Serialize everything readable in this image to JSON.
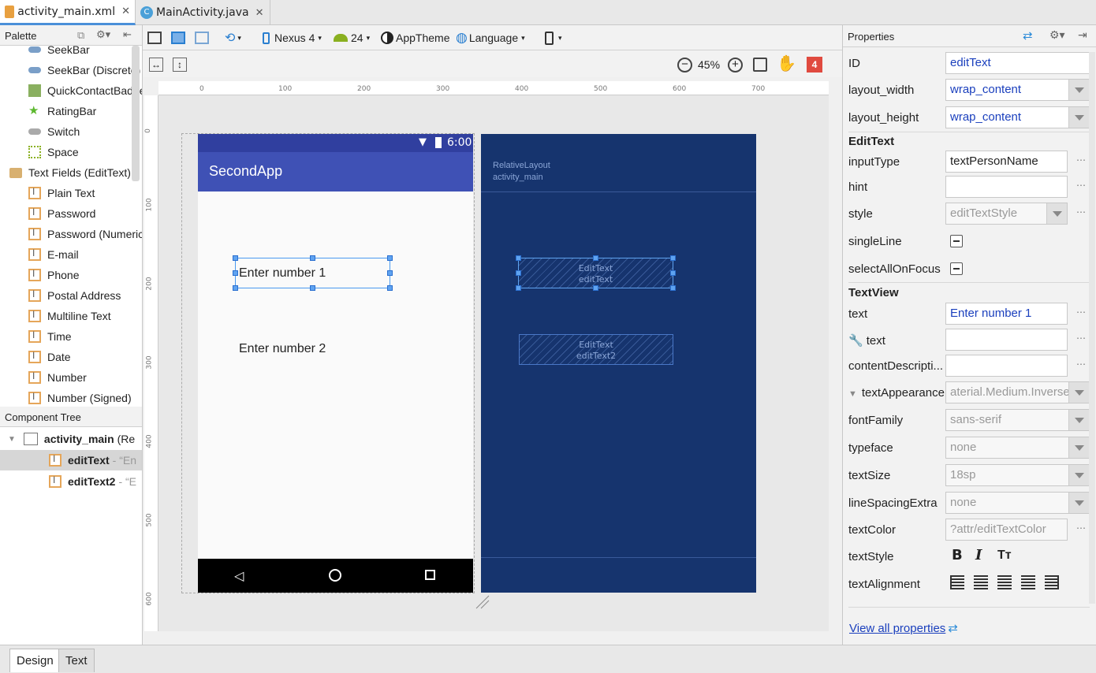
{
  "tabs": [
    {
      "label": "activity_main.xml",
      "active": true
    },
    {
      "label": "MainActivity.java",
      "active": false
    }
  ],
  "palette": {
    "title": "Palette",
    "items": [
      {
        "label": "SeekBar",
        "icon": "seekbar-icon"
      },
      {
        "label": "SeekBar (Discrete)",
        "icon": "seekbar-icon"
      },
      {
        "label": "QuickContactBadge",
        "icon": "contact-badge-icon"
      },
      {
        "label": "RatingBar",
        "icon": "star-icon"
      },
      {
        "label": "Switch",
        "icon": "switch-icon"
      },
      {
        "label": "Space",
        "icon": "space-icon"
      },
      {
        "label": "Text Fields (EditText)",
        "icon": "folder-icon",
        "category": true
      },
      {
        "label": "Plain Text",
        "icon": "edittext-icon"
      },
      {
        "label": "Password",
        "icon": "edittext-icon"
      },
      {
        "label": "Password (Numeric)",
        "icon": "edittext-icon"
      },
      {
        "label": "E-mail",
        "icon": "edittext-icon"
      },
      {
        "label": "Phone",
        "icon": "edittext-icon"
      },
      {
        "label": "Postal Address",
        "icon": "edittext-icon"
      },
      {
        "label": "Multiline Text",
        "icon": "edittext-icon"
      },
      {
        "label": "Time",
        "icon": "edittext-icon"
      },
      {
        "label": "Date",
        "icon": "edittext-icon"
      },
      {
        "label": "Number",
        "icon": "edittext-icon"
      },
      {
        "label": "Number (Signed)",
        "icon": "edittext-icon"
      }
    ]
  },
  "component_tree": {
    "title": "Component Tree",
    "root": {
      "name": "activity_main",
      "suffix": "(Re"
    },
    "children": [
      {
        "name": "editText",
        "hint": "- “En",
        "selected": true
      },
      {
        "name": "editText2",
        "hint": "- “E",
        "selected": false
      }
    ]
  },
  "toolbar": {
    "device": "Nexus 4",
    "api": "24",
    "theme": "AppTheme",
    "language": "Language",
    "zoom": "45%",
    "warnings": "4"
  },
  "ruler": {
    "top": [
      "0",
      "100",
      "200",
      "300",
      "400",
      "500",
      "600",
      "700"
    ],
    "left": [
      "0",
      "100",
      "200",
      "300",
      "400",
      "500",
      "600"
    ]
  },
  "device": {
    "time": "6:00",
    "app_title": "SecondApp",
    "edit1": "Enter number 1",
    "edit2": "Enter number 2"
  },
  "blueprint": {
    "layout_type": "RelativeLayout",
    "layout_id": "activity_main",
    "w1_type": "EditText",
    "w1_id": "editText",
    "w2_type": "EditText",
    "w2_id": "editText2"
  },
  "properties": {
    "title": "Properties",
    "id_label": "ID",
    "id_value": "editText",
    "lw_label": "layout_width",
    "lw_value": "wrap_content",
    "lh_label": "layout_height",
    "lh_value": "wrap_content",
    "sect_edittext": "EditText",
    "inputType_label": "inputType",
    "inputType_value": "textPersonName",
    "hint_label": "hint",
    "hint_value": "",
    "style_label": "style",
    "style_value": "editTextStyle",
    "singleLine_label": "singleLine",
    "selectAll_label": "selectAllOnFocus",
    "sect_textview": "TextView",
    "text_label": "text",
    "text_value": "Enter number 1",
    "tooltext_label": "text",
    "tooltext_value": "",
    "cdesc_label": "contentDescripti...",
    "cdesc_value": "",
    "tapp_label": "textAppearance",
    "tapp_value": "aterial.Medium.Inverse",
    "ff_label": "fontFamily",
    "ff_value": "sans-serif",
    "tf_label": "typeface",
    "tf_value": "none",
    "ts_label": "textSize",
    "ts_value": "18sp",
    "lse_label": "lineSpacingExtra",
    "lse_value": "none",
    "tc_label": "textColor",
    "tc_value": "?attr/editTextColor",
    "tstyle_label": "textStyle",
    "talign_label": "textAlignment",
    "view_all": "View all properties"
  },
  "bottom_tabs": [
    "Design",
    "Text"
  ],
  "colors": {
    "appbar": "#3f51b5",
    "statusbar": "#303f9f",
    "blueprint": "#16346e",
    "selection": "#5fa3f0",
    "warning": "#e04a3f"
  }
}
